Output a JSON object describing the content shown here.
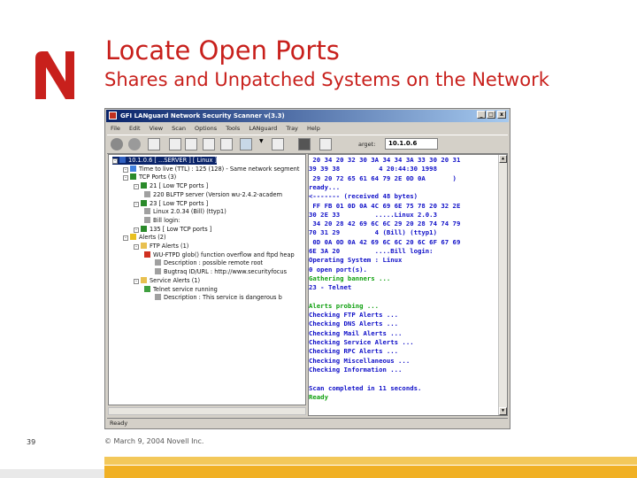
{
  "slide": {
    "title": "Locate Open Ports",
    "subtitle": "Shares and Unpatched Systems on the Network",
    "page_number": "39",
    "copyright": "© March 9, 2004 Novell Inc.",
    "logo_letter": "N",
    "colors": {
      "accent": "#c8201c",
      "gold_light": "#f3c85a",
      "gold_dark": "#f0b024"
    }
  },
  "window": {
    "title": "GFI LANguard Network Security Scanner v(3.3)",
    "menu": [
      "File",
      "Edit",
      "View",
      "Scan",
      "Options",
      "Tools",
      "LANguard",
      "Tray",
      "Help"
    ],
    "target_label": "arget:",
    "target_value": "10.1.0.6",
    "status": "Ready",
    "controls": {
      "minimize": "_",
      "maximize": "□",
      "close": "x"
    }
  },
  "tree": [
    {
      "text": "10.1.0.6 [ ...SERVER ] [ Linux ]",
      "icon": "computer-icon",
      "level": 0,
      "selected": true
    },
    {
      "text": "Time to live (TTL) : 125 (128) - Same network segment",
      "icon": "info-icon",
      "level": 1
    },
    {
      "text": "TCP Ports (3)",
      "icon": "network-icon",
      "level": 1
    },
    {
      "text": "21 [ Low TCP ports ]",
      "icon": "port-icon",
      "level": 2
    },
    {
      "text": "220 BLFTP server (Version wu-2.4.2-academ",
      "icon": "doc-icon",
      "level": 3
    },
    {
      "text": "23 [ Low TCP ports ]",
      "icon": "port-icon",
      "level": 2
    },
    {
      "text": "Linux 2.0.34 (Bill) (ttyp1)",
      "icon": "doc-icon",
      "level": 3
    },
    {
      "text": "Bill login:",
      "icon": "doc-icon",
      "level": 3
    },
    {
      "text": "135 [ Low TCP ports ]",
      "icon": "port-icon",
      "level": 2
    },
    {
      "text": "Alerts (2)",
      "icon": "warning-icon",
      "level": 1
    },
    {
      "text": "FTP Alerts (1)",
      "icon": "folder-icon",
      "level": 2
    },
    {
      "text": "WU-FTPD glob() function overflow and ftpd heap",
      "icon": "alert-icon",
      "level": 3
    },
    {
      "text": "Description : possible remote root",
      "icon": "doc-icon",
      "level": 4
    },
    {
      "text": "Bugtraq ID/URL : http://www.securityfocus",
      "icon": "doc-icon",
      "level": 4
    },
    {
      "text": "Service Alerts (1)",
      "icon": "folder-icon",
      "level": 2
    },
    {
      "text": "Telnet service running",
      "icon": "service-icon",
      "level": 3
    },
    {
      "text": "Description : This service is dangerous b",
      "icon": "doc-icon",
      "level": 4
    }
  ],
  "console": [
    {
      "text": " 20 34 20 32 30 3A 34 34 3A 33 30 20 31",
      "color": "#1010c8"
    },
    {
      "text": "39 39 38          4 20:44:30 1998",
      "color": "#1010c8"
    },
    {
      "text": " 29 20 72 65 61 64 79 2E 0D 0A       )",
      "color": "#1010c8"
    },
    {
      "text": "ready...",
      "color": "#1010c8"
    },
    {
      "text": "<------- (received 48 bytes)",
      "color": "#1010c8"
    },
    {
      "text": " FF FB 01 0D 0A 4C 69 6E 75 78 20 32 2E",
      "color": "#1010c8"
    },
    {
      "text": "30 2E 33         .....Linux 2.0.3",
      "color": "#1010c8"
    },
    {
      "text": " 34 20 28 42 69 6C 6C 29 20 28 74 74 79",
      "color": "#1010c8"
    },
    {
      "text": "70 31 29         4 (Bill) (ttyp1)",
      "color": "#1010c8"
    },
    {
      "text": " 0D 0A 0D 0A 42 69 6C 6C 20 6C 6F 67 69",
      "color": "#1010c8"
    },
    {
      "text": "6E 3A 20         ....Bill login:",
      "color": "#1010c8"
    },
    {
      "text": "Operating System : Linux",
      "color": "#1010c8"
    },
    {
      "text": "0 open port(s).",
      "color": "#1010c8"
    },
    {
      "text": "Gathering banners ...",
      "color": "#10a010"
    },
    {
      "text": "23 - Telnet",
      "color": "#1010c8"
    },
    {
      "text": "",
      "color": "#1010c8"
    },
    {
      "text": "Alerts probing ...",
      "color": "#10a010"
    },
    {
      "text": "Checking FTP Alerts ...",
      "color": "#1010c8"
    },
    {
      "text": "Checking DNS Alerts ...",
      "color": "#1010c8"
    },
    {
      "text": "Checking Mail Alerts ...",
      "color": "#1010c8"
    },
    {
      "text": "Checking Service Alerts ...",
      "color": "#1010c8"
    },
    {
      "text": "Checking RPC Alerts ...",
      "color": "#1010c8"
    },
    {
      "text": "Checking Miscellaneous ...",
      "color": "#1010c8"
    },
    {
      "text": "Checking Information ...",
      "color": "#1010c8"
    },
    {
      "text": "",
      "color": "#1010c8"
    },
    {
      "text": "Scan completed in 11 seconds.",
      "color": "#1010c8"
    },
    {
      "text": "Ready",
      "color": "#10a010"
    }
  ],
  "icons": {
    "colors": {
      "computer-icon": "#3060c0",
      "info-icon": "#4080e0",
      "network-icon": "#2a8a2a",
      "port-icon": "#2a8a2a",
      "doc-icon": "#a0a0a0",
      "warning-icon": "#e8c020",
      "folder-icon": "#e8c050",
      "alert-icon": "#d03020",
      "service-icon": "#40a040"
    }
  }
}
